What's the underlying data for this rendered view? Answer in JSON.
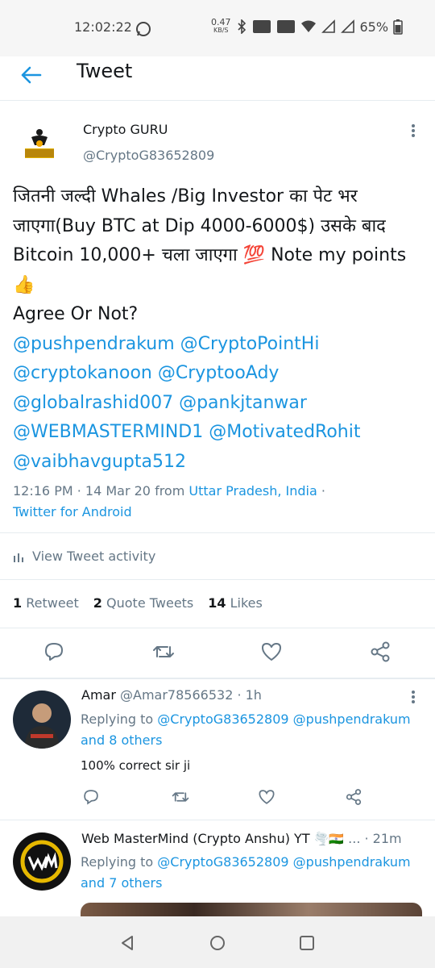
{
  "status": {
    "time": "12:02:22",
    "speed": "0.47",
    "speed_unit": "KB/S",
    "battery": "65%"
  },
  "header": {
    "title": "Tweet"
  },
  "tweet": {
    "name": "Crypto GURU",
    "handle": "@CryptoG83652809",
    "line1": "जितनी जल्दी Whales /Big Investor का पेट भर",
    "line2": "जाएगा(Buy BTC at Dip 4000-6000$) उसके बाद",
    "line3": "Bitcoin 10,000+ चला जाएगा 💯 Note my points",
    "line4": "👍",
    "line5": "Agree Or Not?",
    "mentions1": "@pushpendrakum @CryptoPointHi",
    "mentions2": "@cryptokanoon @CryptooAdy",
    "mentions3": "@globalrashid007 @pankjtanwar",
    "mentions4": "@WEBMASTERMIND1 @MotivatedRohit",
    "mentions5": "@vaibhavgupta512",
    "timestamp": "12:16 PM · 14 Mar 20 from ",
    "location": "Uttar Pradesh, India",
    "loc_sep": " ·",
    "client": "Twitter for Android",
    "activity": "View Tweet activity",
    "retweets": "1",
    "retweets_label": "Retweet",
    "quotes": "2",
    "quotes_label": "Quote Tweets",
    "likes": "14",
    "likes_label": "Likes"
  },
  "replies": [
    {
      "name": "Amar",
      "handle": "@Amar78566532 · 1h",
      "replying_prefix": "Replying to ",
      "replying_to": "@CryptoG83652809 @pushpendrakum",
      "others": "and 8 others",
      "text": "100% correct sir ji"
    },
    {
      "name": "Web MasterMind (Crypto Anshu) YT",
      "name_emoji": "🌪️🇮🇳",
      "handle": "... · 21m",
      "replying_prefix": "Replying to ",
      "replying_to": "@CryptoG83652809 @pushpendrakum",
      "others": "and 7 others"
    }
  ],
  "colors": {
    "accent": "#1b95e0",
    "secondary": "#657786",
    "divider": "#e6ecf0"
  }
}
